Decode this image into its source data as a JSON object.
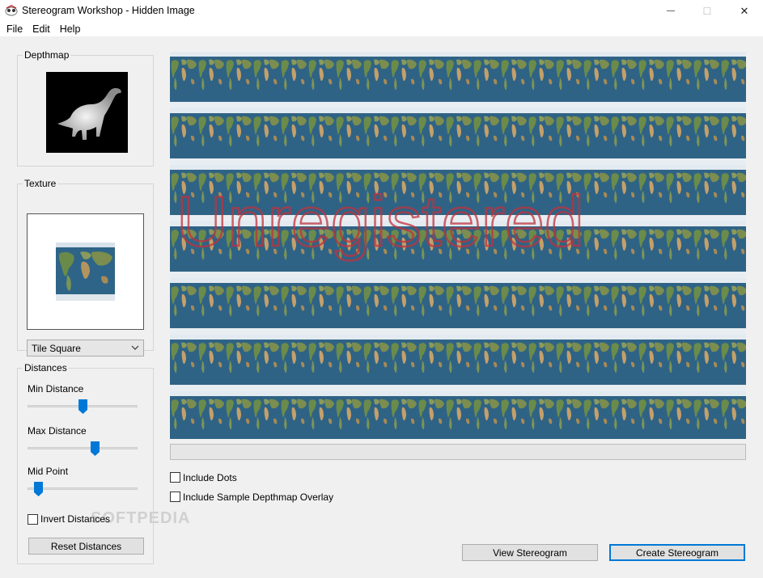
{
  "window": {
    "title": "Stereogram Workshop - Hidden Image",
    "minimize_glyph": "—",
    "maximize_glyph": "☐",
    "close_glyph": "✕"
  },
  "menu": {
    "items": [
      {
        "label": "File"
      },
      {
        "label": "Edit"
      },
      {
        "label": "Help"
      }
    ]
  },
  "depthmap": {
    "title": "Depthmap"
  },
  "texture": {
    "title": "Texture",
    "mode_selected": "Tile Square"
  },
  "distances": {
    "title": "Distances",
    "min_label": "Min Distance",
    "min_value": 0.5,
    "max_label": "Max Distance",
    "max_value": 0.6,
    "mid_label": "Mid Point",
    "mid_value": 0.05,
    "invert_label": "Invert Distances",
    "invert_checked": false,
    "reset_label": "Reset Distances"
  },
  "preview": {
    "watermark_text": "Unregistered",
    "progress": 0
  },
  "options": {
    "include_dots_label": "Include Dots",
    "include_dots_checked": false,
    "include_overlay_label": "Include Sample Depthmap Overlay",
    "include_overlay_checked": false
  },
  "actions": {
    "view_label": "View Stereogram",
    "create_label": "Create Stereogram"
  },
  "site_watermark": "SOFTPEDIA",
  "colors": {
    "accent": "#0078d7",
    "watermark": "#c0323c"
  },
  "icons": {
    "app": "stereogram-app-icon",
    "dropdown": "chevron-down-icon",
    "minimize": "minimize-icon",
    "maximize": "maximize-icon",
    "close": "close-icon"
  }
}
